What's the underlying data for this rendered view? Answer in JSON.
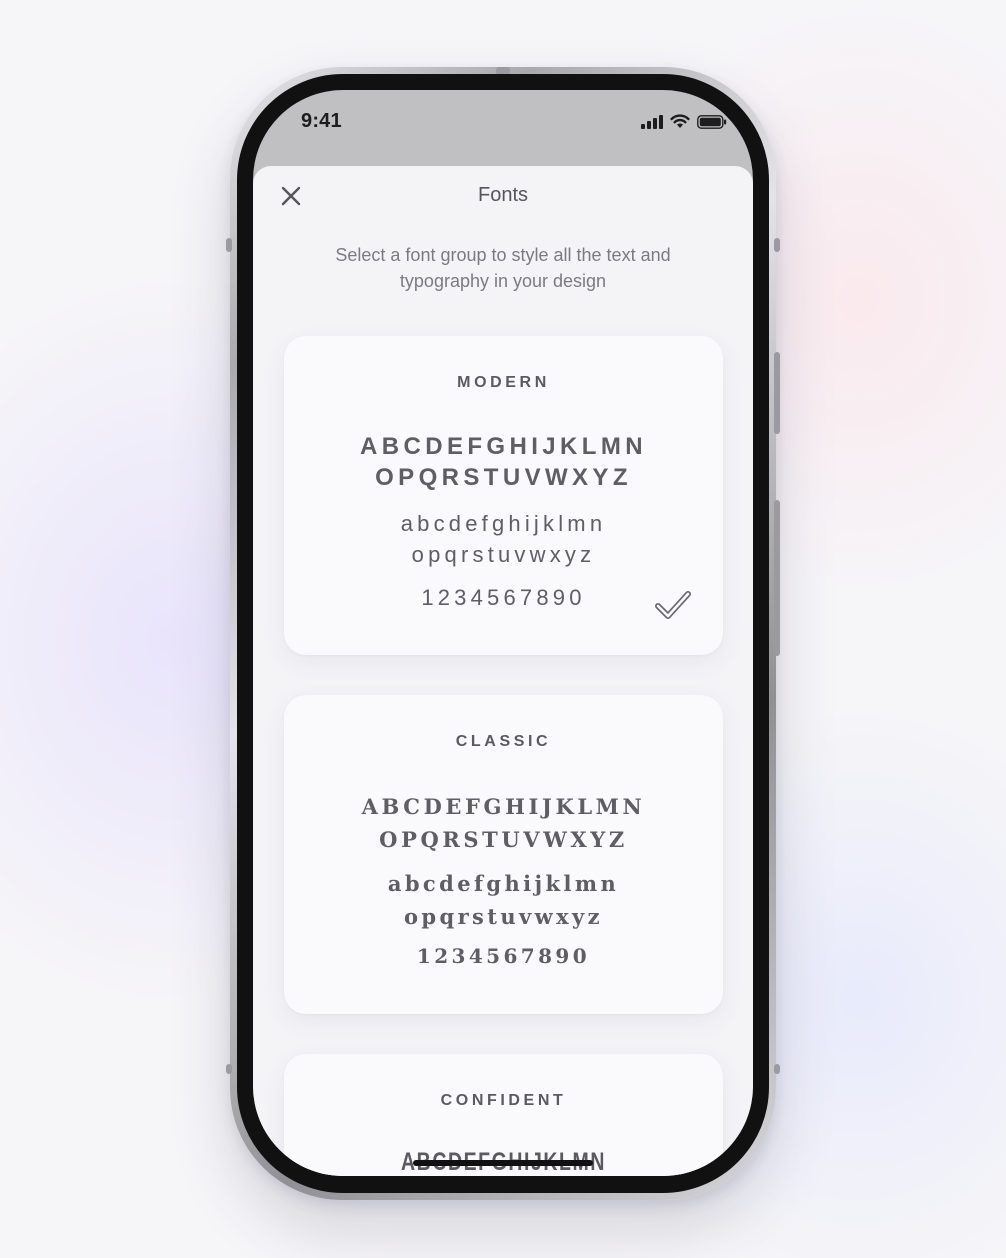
{
  "status_bar": {
    "time": "9:41"
  },
  "sheet": {
    "title": "Fonts",
    "subtitle_line1": "Select a font group to style all the text and",
    "subtitle_line2": "typography in your design"
  },
  "font_groups": [
    {
      "name": "MODERN",
      "upper_line1": "ABCDEFGHIJKLMN",
      "upper_line2": "OPQRSTUVWXYZ",
      "lower_line1": "abcdefghijklmn",
      "lower_line2": "opqrstuvwxyz",
      "digits": "1234567890",
      "selected": true
    },
    {
      "name": "CLASSIC",
      "upper_line1": "ABCDEFGHIJKLMN",
      "upper_line2": "OPQRSTUVWXYZ",
      "lower_line1": "abcdefghijklmn",
      "lower_line2": "opqrstuvwxyz",
      "digits": "1234567890",
      "selected": false
    },
    {
      "name": "CONFIDENT",
      "upper_line1": "ABCDEFGHIJKLMN",
      "selected": false
    }
  ],
  "icons": {
    "close": "close-icon",
    "selected": "checkmark-icon",
    "signal": "cellular-signal-icon",
    "wifi": "wifi-icon",
    "battery": "battery-icon"
  },
  "colors": {
    "sheet_background": "#f4f4f7",
    "card_background": "#fafafc",
    "text_primary": "#5e5e63",
    "text_secondary": "#7a7a80"
  }
}
